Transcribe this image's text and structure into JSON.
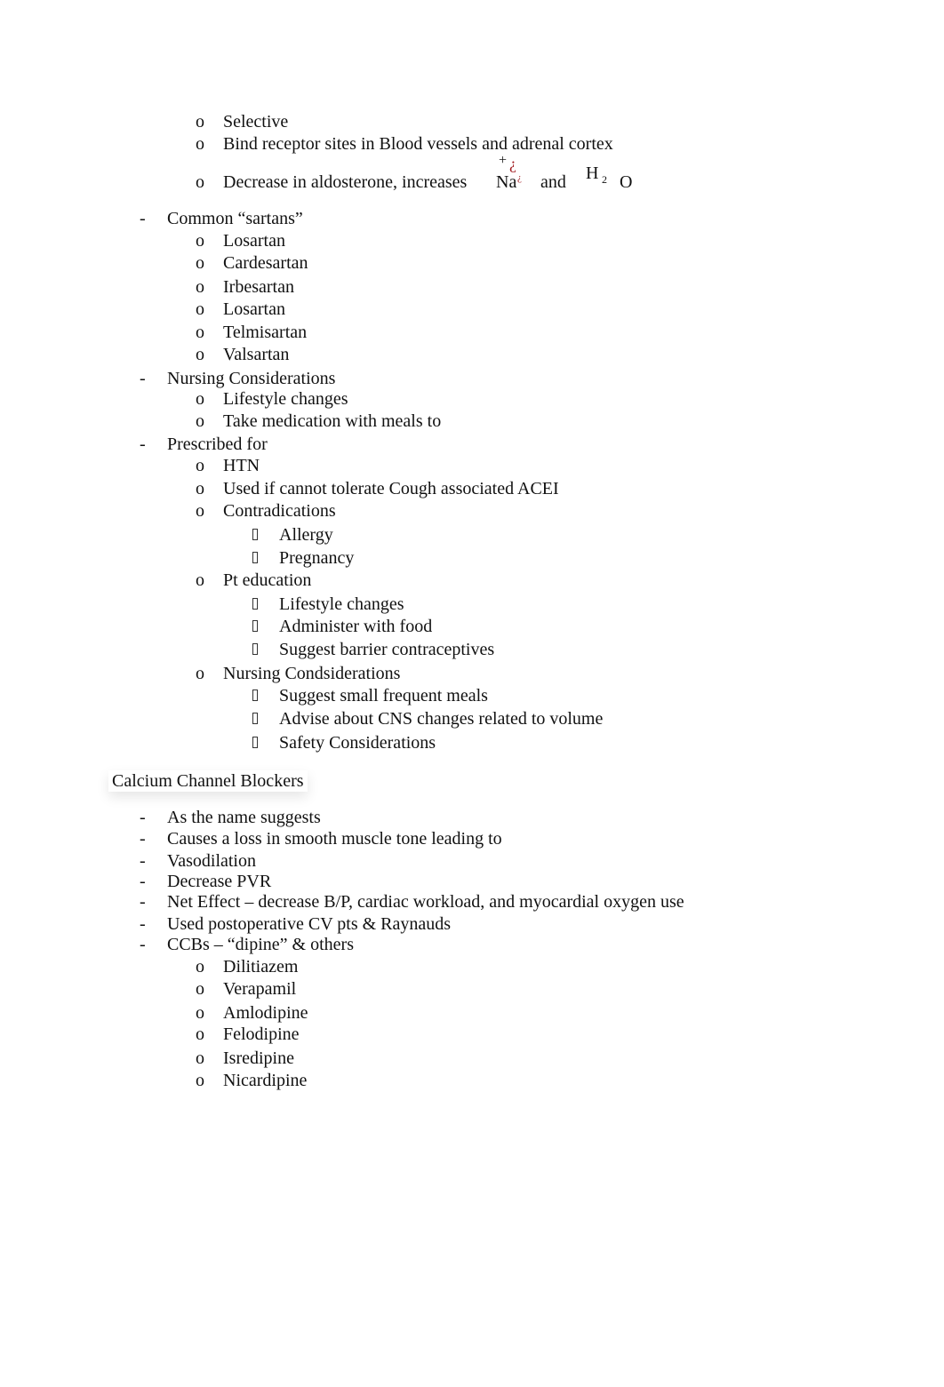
{
  "document": {
    "arb_section": {
      "intro_items": [
        {
          "bullet": "o",
          "text": "Selective"
        },
        {
          "bullet": "o",
          "text": "Bind receptor sites in Blood vessels and adrenal cortex"
        }
      ],
      "aldosterone_item": {
        "bullet": "o",
        "text": "Decrease in aldosterone, increases",
        "formula_na": {
          "base": "Na",
          "superscript_plus": "+",
          "superscript_glyph": "¿",
          "subscript_glyph": "¿"
        },
        "conjunction": "and",
        "formula_h2o": {
          "h": "H",
          "sub": "2",
          "o": "O"
        }
      },
      "groups": [
        {
          "bullet": "-",
          "title": "Common “sartans”",
          "items": [
            {
              "bullet": "o",
              "text": "Losartan"
            },
            {
              "bullet": "o",
              "text": "Cardesartan"
            },
            {
              "bullet": "o",
              "text": "Irbesartan"
            },
            {
              "bullet": "o",
              "text": "Losartan"
            },
            {
              "bullet": "o",
              "text": "Telmisartan"
            },
            {
              "bullet": "o",
              "text": "Valsartan"
            }
          ]
        },
        {
          "bullet": "-",
          "title": "Nursing Considerations",
          "items": [
            {
              "bullet": "o",
              "text": "Lifestyle changes"
            },
            {
              "bullet": "o",
              "text": "Take medication with meals to"
            }
          ]
        },
        {
          "bullet": "-",
          "title": "Prescribed for",
          "items": [
            {
              "bullet": "o",
              "text": "HTN"
            },
            {
              "bullet": "o",
              "text": "Used if cannot tolerate Cough associated ACEI"
            },
            {
              "bullet": "o",
              "text": "Contradications",
              "subitems": [
                "Allergy",
                "Pregnancy"
              ]
            },
            {
              "bullet": "o",
              "text": "Pt education",
              "subitems": [
                "Lifestyle changes",
                "Administer with food",
                "Suggest barrier contraceptives"
              ]
            },
            {
              "bullet": "o",
              "text": "Nursing Condsiderations",
              "subitems": [
                "Suggest small frequent meals",
                "Advise about CNS changes related to volume",
                "Safety Considerations"
              ]
            }
          ]
        }
      ]
    },
    "ccb_section": {
      "heading": "Calcium Channel Blockers",
      "items": [
        {
          "bullet": "-",
          "text": "As the name suggests"
        },
        {
          "bullet": "-",
          "text": "Causes a loss in smooth muscle tone leading to"
        },
        {
          "bullet": "-",
          "text": "Vasodilation"
        },
        {
          "bullet": "-",
          "text": "Decrease PVR"
        },
        {
          "bullet": "-",
          "text": "Net Effect – decrease B/P, cardiac workload, and myocardial oxygen use"
        },
        {
          "bullet": "-",
          "text": "Used postoperative CV pts & Raynauds"
        },
        {
          "bullet": "-",
          "text": "CCBs – “dipine” & others"
        }
      ],
      "drugs": [
        {
          "bullet": "o",
          "text": "Dilitiazem"
        },
        {
          "bullet": "o",
          "text": "Verapamil"
        },
        {
          "bullet": "o",
          "text": "Amlodipine"
        },
        {
          "bullet": "o",
          "text": "Felodipine"
        },
        {
          "bullet": "o",
          "text": "Isredipine"
        },
        {
          "bullet": "o",
          "text": "Nicardipine"
        }
      ]
    },
    "colors": {
      "text": "#111111",
      "error_glyph": "#a0191e",
      "background": "#ffffff"
    },
    "icons": {
      "level3_bullet": "missing-glyph-box"
    }
  }
}
